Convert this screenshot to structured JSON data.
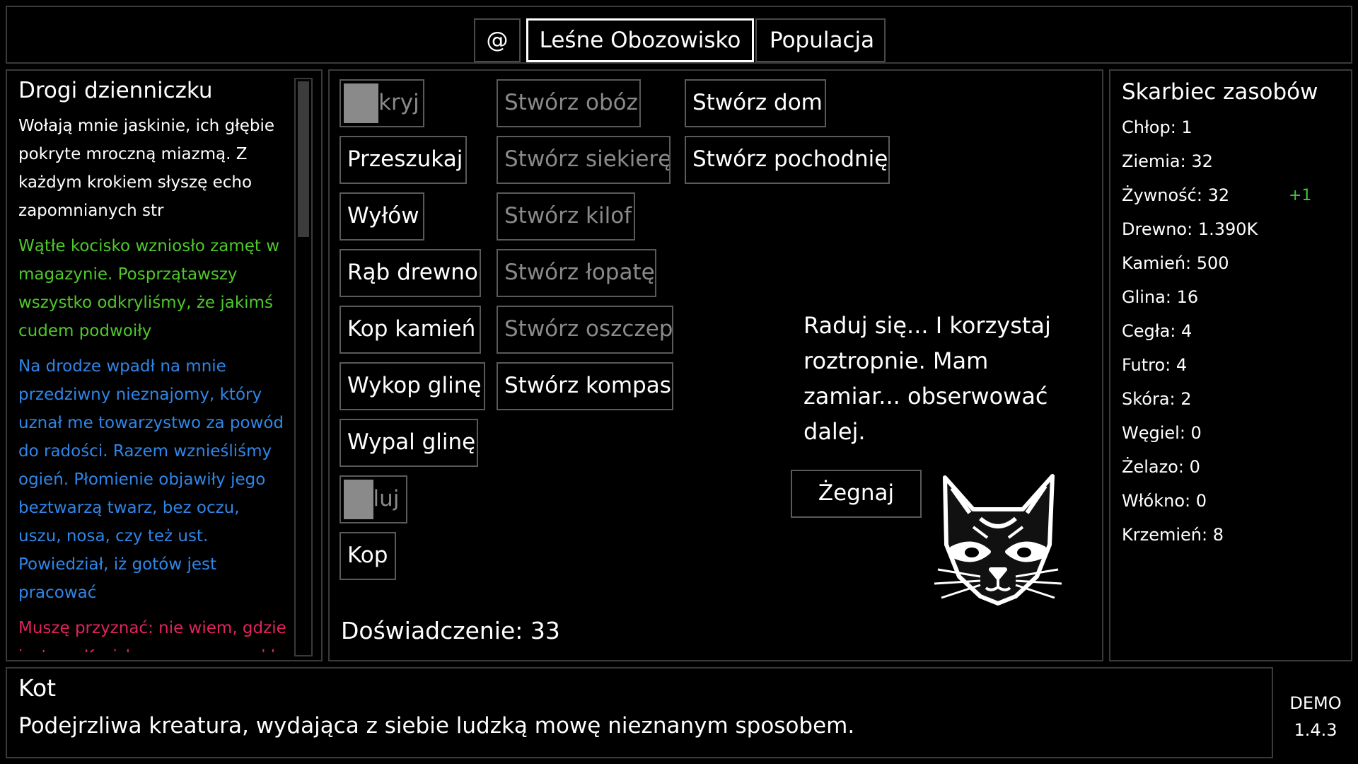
{
  "tabs": [
    {
      "label": "@"
    },
    {
      "label": "Leśne Obozowisko"
    },
    {
      "label": "Populacja"
    }
  ],
  "journal": {
    "title": "Drogi dzienniczku",
    "entries": [
      {
        "text": "Wołają mnie jaskinie, ich głębie pokryte mroczną miazmą. Z każdym krokiem słyszę echo zapomnianych str",
        "color": "#ffffff"
      },
      {
        "text": "Wątłe kocisko wzniosło zamęt w magazynie. Posprzątawszy wszystko odkryliśmy, że jakimś cudem podwoiły",
        "color": "#4ec82a"
      },
      {
        "text": "Na drodze wpadł na mnie przedziwny nieznajomy, który uznał me towarzystwo za powód do radości. Razem wznieśliśmy ogień. Płomienie objawiły jego beztwarzą twarz, bez oczu, uszu, nosa, czy też ust. Powiedział, iż gotów jest pracować",
        "color": "#2f86e8"
      },
      {
        "text": "Muszę przyznać: nie wiem, gdzie jestem. Kocisko szczerzy swe kły w półmroku. Po chwili",
        "color": "#e0245f"
      }
    ]
  },
  "actions": {
    "col1": [
      {
        "label": "Odkryj",
        "disabled": true
      },
      {
        "label": "Przeszukaj",
        "disabled": false
      },
      {
        "label": "Wyłów",
        "disabled": false
      },
      {
        "label": "Rąb drewno",
        "disabled": false
      },
      {
        "label": "Kop kamień",
        "disabled": false
      },
      {
        "label": "Wykop glinę",
        "disabled": false
      },
      {
        "label": "Wypal glinę",
        "disabled": false
      },
      {
        "label": "Poluj",
        "disabled": true
      },
      {
        "label": "Kop",
        "disabled": false
      }
    ],
    "col2": [
      {
        "label": "Stwórz obóz",
        "disabled": true
      },
      {
        "label": "Stwórz siekierę",
        "disabled": true
      },
      {
        "label": "Stwórz kilof",
        "disabled": true
      },
      {
        "label": "Stwórz łopatę",
        "disabled": true
      },
      {
        "label": "Stwórz oszczep",
        "disabled": true
      },
      {
        "label": "Stwórz kompas",
        "disabled": false
      }
    ],
    "col3": [
      {
        "label": "Stwórz dom",
        "disabled": false
      },
      {
        "label": "Stwórz pochodnię",
        "disabled": false
      }
    ],
    "cooldowns": {
      "odkryj": 0.45,
      "poluj": 0.5
    }
  },
  "experience": "Doświadczenie: 33",
  "dialog": {
    "text": "Raduj się... I korzystaj roztropnie. Mam zamiar... obserwować dalej.",
    "button": "Żegnaj",
    "icon": "cat-face-icon"
  },
  "resources": {
    "title": "Skarbiec zasobów",
    "items": [
      {
        "text": "Chłop: 1",
        "rate": ""
      },
      {
        "text": "Ziemia: 32",
        "rate": ""
      },
      {
        "text": "Żywność: 32",
        "rate": "+1"
      },
      {
        "text": "Drewno: 1.390K",
        "rate": ""
      },
      {
        "text": "Kamień: 500",
        "rate": ""
      },
      {
        "text": "Glina: 16",
        "rate": ""
      },
      {
        "text": "Cegła: 4",
        "rate": ""
      },
      {
        "text": "Futro: 4",
        "rate": ""
      },
      {
        "text": "Skóra: 2",
        "rate": ""
      },
      {
        "text": "Węgiel: 0",
        "rate": ""
      },
      {
        "text": "Żelazo: 0",
        "rate": ""
      },
      {
        "text": "Włókno: 0",
        "rate": ""
      },
      {
        "text": "Krzemień: 8",
        "rate": ""
      }
    ]
  },
  "info": {
    "title": "Kot",
    "description": "Podejrzliwa kreatura, wydająca z siebie ludzką mowę nieznanym sposobem."
  },
  "build": {
    "label": "DEMO",
    "version": "1.4.3"
  }
}
